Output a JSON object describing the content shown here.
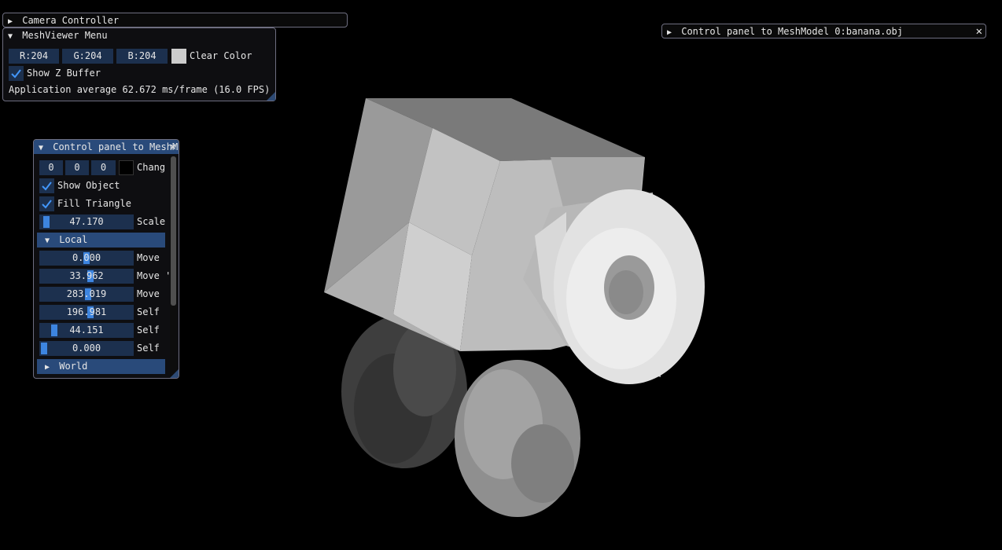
{
  "camera_controller": {
    "title": "Camera Controller"
  },
  "meshviewer_menu": {
    "title": "MeshViewer Menu",
    "r_field": "R:204",
    "g_field": "G:204",
    "b_field": "B:204",
    "clear_color_label": "Clear Color",
    "clear_color_swatch": "#cccccc",
    "show_z_buffer_label": "Show Z Buffer",
    "show_z_buffer_checked": true,
    "fps_text": "Application average 62.672 ms/frame (16.0 FPS)"
  },
  "model_panel_collapsed": {
    "title": "Control panel to MeshModel 0:banana.obj",
    "close_symbol": "✕"
  },
  "model_panel": {
    "title": "Control panel to MeshM",
    "close_symbol": "✕",
    "color_fields": [
      "0",
      "0",
      "0"
    ],
    "color_swatch": "#000000",
    "change_label": "Chang",
    "show_object_label": "Show Object",
    "show_object_checked": true,
    "fill_triangle_label": "Fill Triangle",
    "fill_triangle_checked": true,
    "scale_value": "47.170",
    "scale_label": "Scale",
    "scale_level": 0.03,
    "local_header": "Local",
    "local_sliders": [
      {
        "value": "0.000",
        "label": "Move",
        "level": 0.5
      },
      {
        "value": "33.962",
        "label": "Move '",
        "level": 0.55
      },
      {
        "value": "283.019",
        "label": "Move",
        "level": 0.52
      },
      {
        "value": "196.981",
        "label": "Self",
        "level": 0.55
      },
      {
        "value": "44.151",
        "label": "Self",
        "level": 0.12
      },
      {
        "value": "0.000",
        "label": "Self",
        "level": 0.0
      }
    ],
    "world_header": "World"
  },
  "scene": {
    "background": "#000000",
    "mesh_color": "#cccccc"
  }
}
